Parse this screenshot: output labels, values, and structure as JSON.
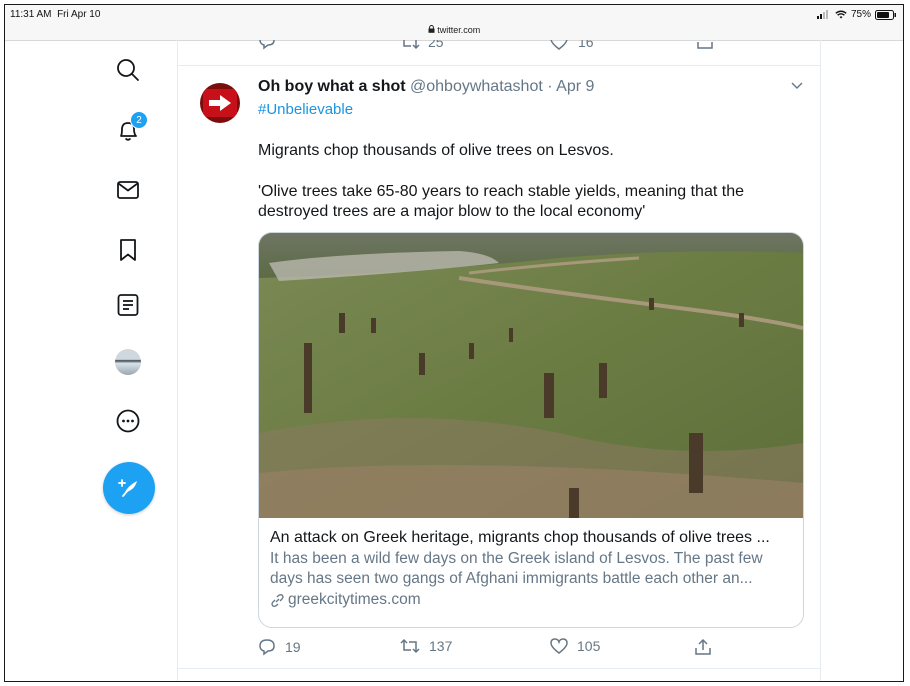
{
  "status_bar": {
    "time": "11:31 AM",
    "date": "Fri Apr 10",
    "battery": "75%"
  },
  "browser": {
    "url": "twitter.com"
  },
  "sidebar": {
    "notifications_badge": "2",
    "items": [
      {
        "name": "search-icon"
      },
      {
        "name": "notifications-icon"
      },
      {
        "name": "messages-icon"
      },
      {
        "name": "bookmarks-icon"
      },
      {
        "name": "lists-icon"
      },
      {
        "name": "profile-avatar"
      },
      {
        "name": "more-icon"
      }
    ]
  },
  "previous_tweet": {
    "retweets": "25",
    "likes": "16"
  },
  "tweet": {
    "display_name": "Oh boy what a shot",
    "handle": "@ohboywhatashot",
    "separator": "·",
    "date": "Apr 9",
    "hashtag": "#Unbelievable",
    "text_line1": "Migrants chop thousands of olive trees on Lesvos.",
    "text_line2": "'Olive trees take 65-80 years to reach stable yields, meaning that the destroyed trees are a major blow to the local economy'",
    "card": {
      "title": "An attack on Greek heritage, migrants chop thousands of olive trees ...",
      "description_line1": "It has been a wild few days on the Greek island of Lesvos. The past few",
      "description_line2": "days has seen two gangs of Afghani immigrants battle each other an...",
      "domain": "greekcitytimes.com"
    },
    "replies": "19",
    "retweets": "137",
    "likes": "105"
  },
  "colors": {
    "accent": "#1da1f2",
    "text_secondary": "#657786",
    "border": "#e6ecf0"
  }
}
